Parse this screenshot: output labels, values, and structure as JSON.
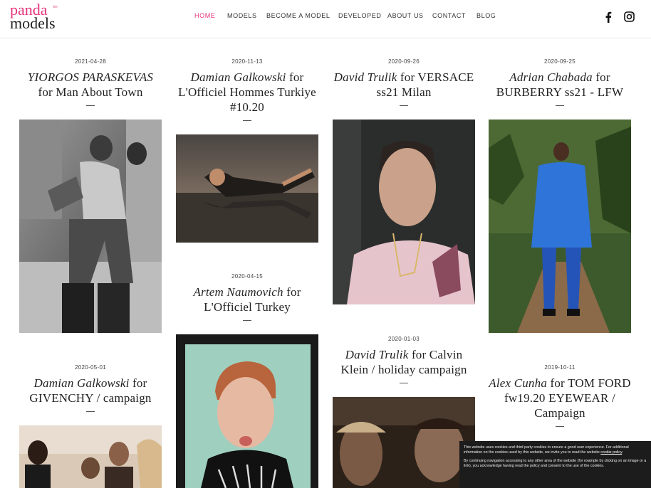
{
  "logo": {
    "line1": "panda",
    "line2": "models",
    "tm": "tm"
  },
  "nav": {
    "items": [
      {
        "label": "HOME",
        "active": true
      },
      {
        "label": "MODELS"
      },
      {
        "label": "BECOME A MODEL"
      },
      {
        "label": "DEVELOPED"
      },
      {
        "label": "ABOUT US"
      },
      {
        "label": "CONTACT"
      },
      {
        "label": "BLOG"
      }
    ]
  },
  "social": {
    "facebook": "facebook-icon",
    "instagram": "instagram-icon"
  },
  "posts": [
    {
      "date": "2021-04-28",
      "name": "YIORGOS PARASKEVAS",
      "rest": "for Man About Town"
    },
    {
      "date": "2020-11-13",
      "name": "Damian Galkowski",
      "rest": "for L'Officiel Hommes Turkiye #10.20"
    },
    {
      "date": "2020-09-26",
      "name": "David Trulik",
      "rest": "for VERSACE ss21 Milan"
    },
    {
      "date": "2020-09-25",
      "name": "Adrian Chabada",
      "rest": "for BURBERRY ss21 - LFW"
    },
    {
      "date": "2020-04-15",
      "name": "Artem Naumovich",
      "rest": "for L'Officiel Turkey"
    },
    {
      "date": "2020-01-03",
      "name": "David Trulik",
      "rest": "for Calvin Klein / holiday campaign"
    },
    {
      "date": "2020-05-01",
      "name": "Damian Galkowski",
      "rest": "for GIVENCHY / campaign"
    },
    {
      "date": "2019-10-11",
      "name": "Alex Cunha",
      "rest": "for TOM FORD fw19.20 EYEWEAR / Campaign"
    }
  ],
  "cookie": {
    "text1": "This website uses cookies and third party cookies to ensure a good user experience. For additional information on the cookies used by this website, we invite you to read the website",
    "link": "cookie policy",
    "text1_end": ".",
    "text2": "By continuing navigation accessing to any other area of the website (for example by clicking on an image or a link), you acknowledge having read the policy and consent to the use of the cookies."
  }
}
